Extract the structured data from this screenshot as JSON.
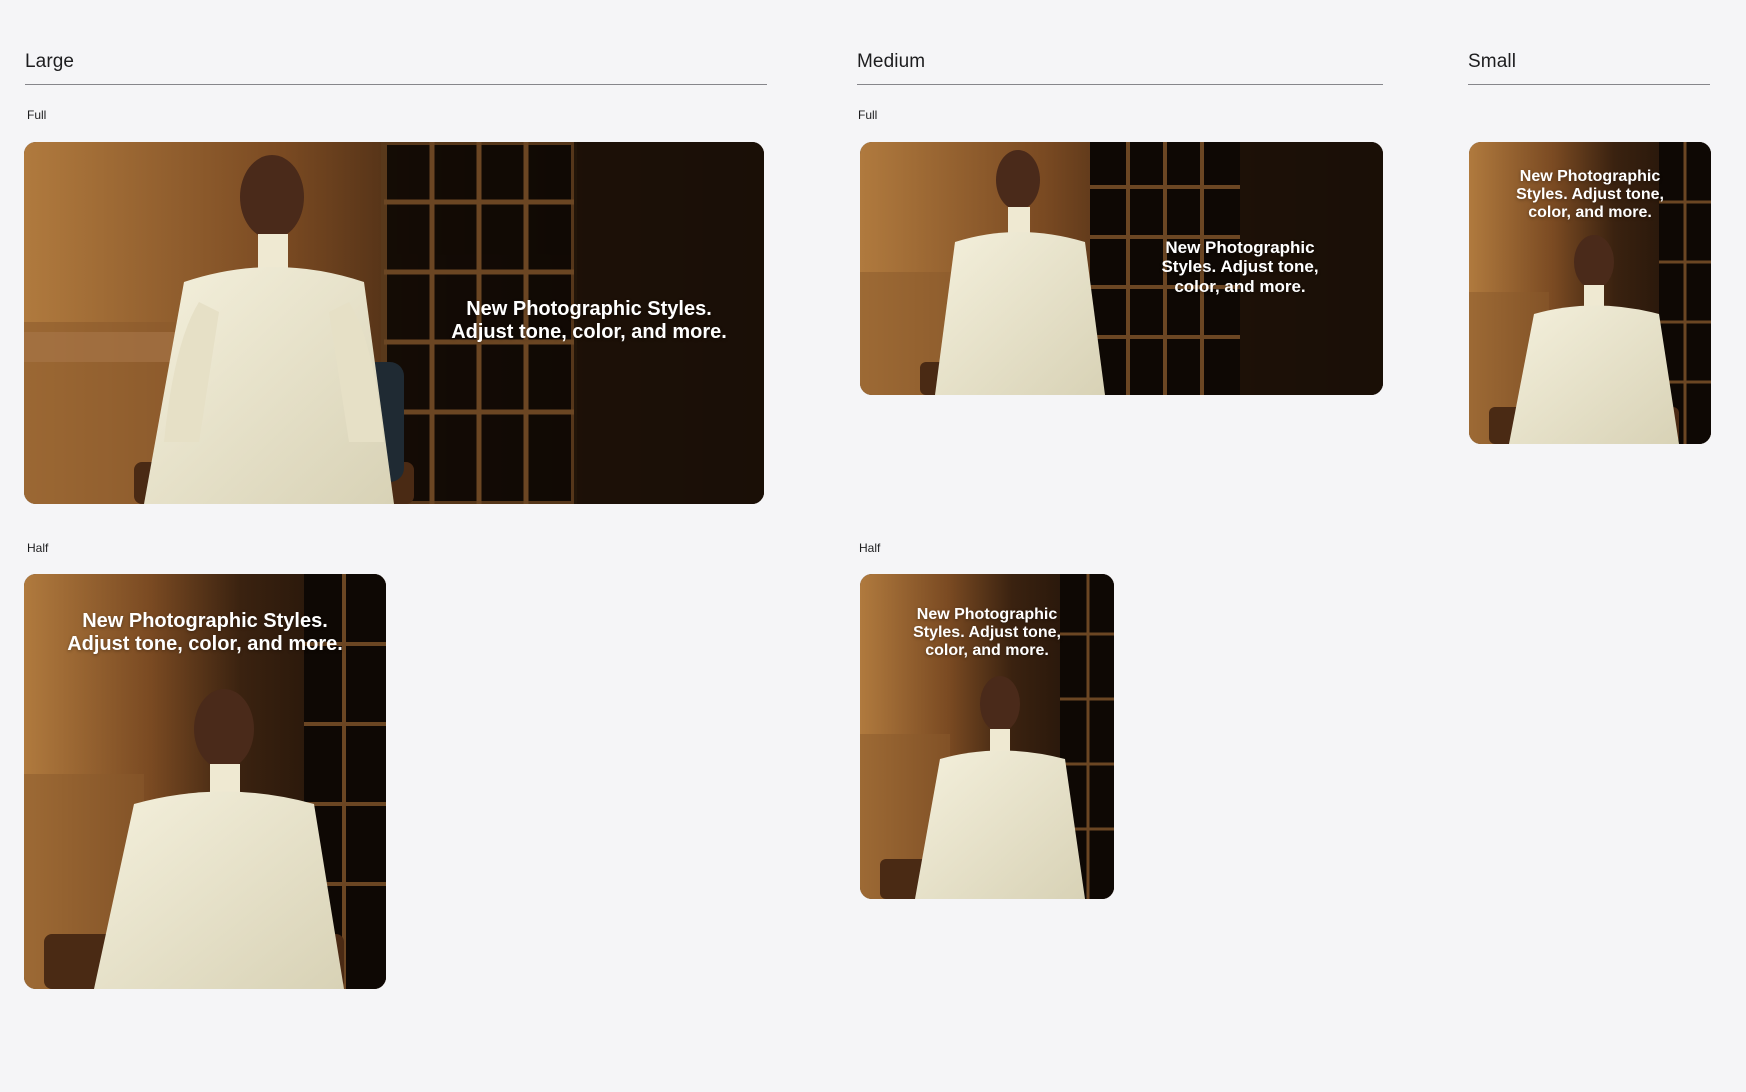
{
  "sections": {
    "large": {
      "title": "Large",
      "full": {
        "label": "Full",
        "headline": "New Photographic Styles.\nAdjust tone, color, and more."
      },
      "half": {
        "label": "Half",
        "headline": "New Photographic Styles.\nAdjust tone, color, and more."
      }
    },
    "medium": {
      "title": "Medium",
      "full": {
        "label": "Full",
        "headline": "New Photographic\nStyles. Adjust tone,\ncolor, and more."
      },
      "half": {
        "label": "Half",
        "headline": "New Photographic\nStyles. Adjust tone,\ncolor, and more."
      }
    },
    "small": {
      "title": "Small",
      "full": {
        "headline": "New Photographic\nStyles. Adjust tone,\ncolor, and more."
      }
    }
  },
  "colors": {
    "background": "#f5f5f7",
    "text": "#1d1d1f",
    "rule": "#86868b",
    "headline": "#ffffff"
  }
}
